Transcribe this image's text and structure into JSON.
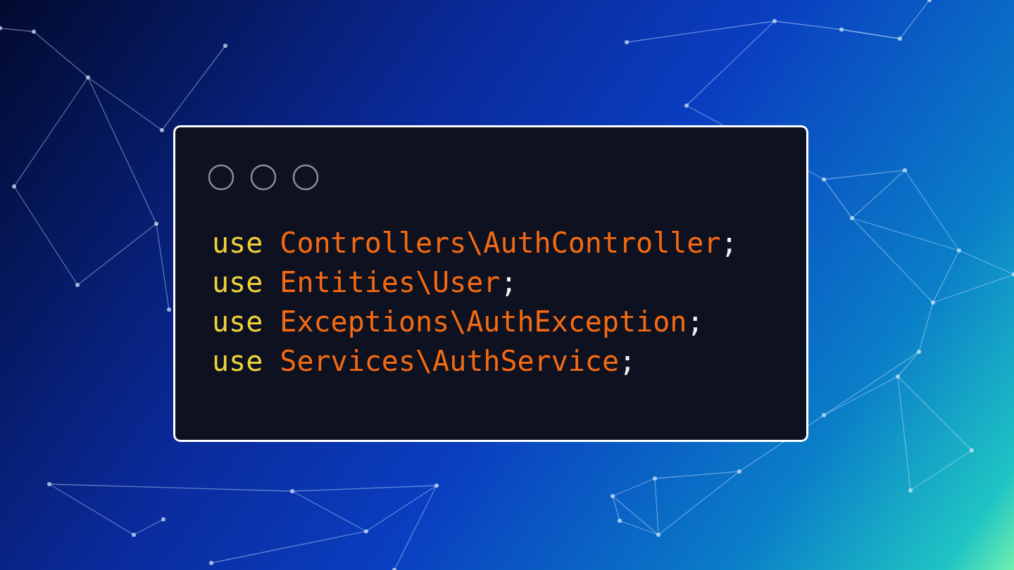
{
  "window": {
    "controls": [
      {
        "kind": "circle"
      },
      {
        "kind": "circle"
      },
      {
        "kind": "circle"
      }
    ]
  },
  "code": [
    {
      "tokens": [
        {
          "kind": "keyword",
          "text": "use"
        },
        {
          "kind": "name",
          "text": "Controllers\\AuthController"
        },
        {
          "kind": "punct",
          "text": ";"
        }
      ]
    },
    {
      "tokens": [
        {
          "kind": "keyword",
          "text": "use"
        },
        {
          "kind": "name",
          "text": "Entities\\User"
        },
        {
          "kind": "punct",
          "text": ";"
        }
      ]
    },
    {
      "tokens": [
        {
          "kind": "keyword",
          "text": "use"
        },
        {
          "kind": "name",
          "text": "Exceptions\\AuthException"
        },
        {
          "kind": "punct",
          "text": ";"
        }
      ]
    },
    {
      "tokens": [
        {
          "kind": "keyword",
          "text": "use"
        },
        {
          "kind": "name",
          "text": "Services\\AuthService"
        },
        {
          "kind": "punct",
          "text": ";"
        }
      ]
    }
  ]
}
